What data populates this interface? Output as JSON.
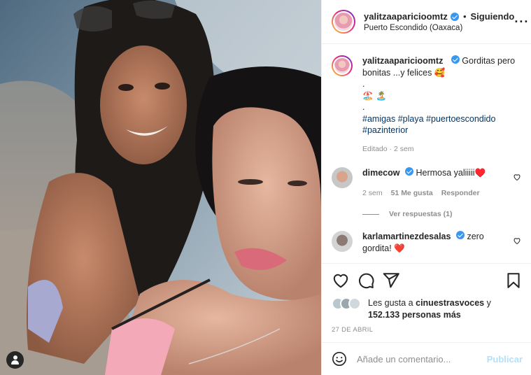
{
  "post": {
    "username": "yalitzaaparicioomtz",
    "follow_status": "Siguiendo",
    "separator": "•",
    "location": "Puerto Escondido (Oaxaca)",
    "more_icon": "more-horizontal-icon",
    "caption": {
      "text": "Gorditas pero bonitas ...y felices 🥰",
      "line2": ".",
      "line3": "🏖️ 🏝️",
      "line4": ".",
      "hashtags": "#amigas #playa #puertoescondido #pazinterior",
      "edited": "Editado · 2 sem"
    }
  },
  "comments": [
    {
      "username": "dimecow",
      "text": "Hermosa yaliiiii♥️",
      "time": "2 sem",
      "likes": "51 Me gusta",
      "reply_label": "Responder",
      "view_replies": "Ver respuestas (1)"
    },
    {
      "username": "karlamartinezdesalas",
      "text": "zero gordita!",
      "text_emoji": "❤️"
    }
  ],
  "actions": {
    "like_icon": "heart-icon",
    "comment_icon": "comment-icon",
    "share_icon": "share-icon",
    "save_icon": "bookmark-icon"
  },
  "likes": {
    "prefix": "Les gusta a",
    "user": "cinuestrasvoces",
    "conj": "y",
    "count": "152.133 personas más"
  },
  "date": "27 DE ABRIL",
  "composer": {
    "placeholder": "Añade un comentario...",
    "publish_label": "Publicar",
    "emoji_icon": "emoji-icon"
  },
  "colors": {
    "verified": "#3897f0",
    "link": "#00376b",
    "publish_disabled": "#b2dffc",
    "secondary_text": "#8e8e8e"
  }
}
